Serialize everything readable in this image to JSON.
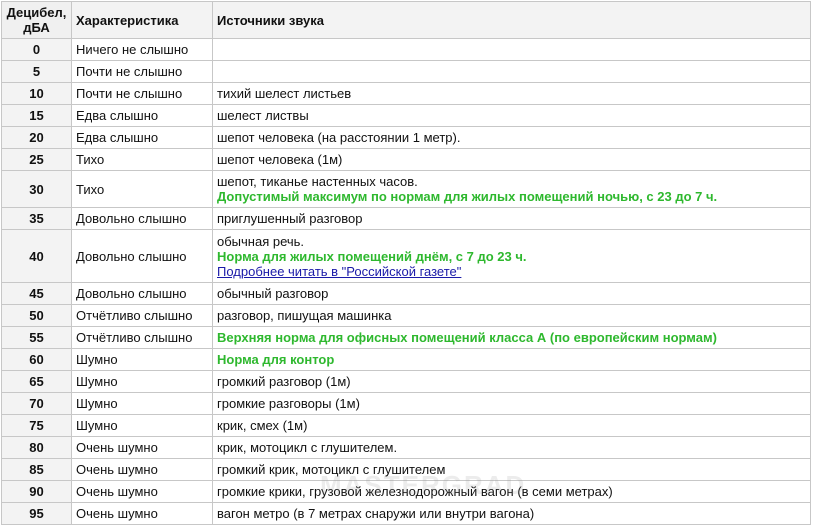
{
  "header": {
    "db": "Децибел, дБА",
    "char": "Характеристика",
    "src": "Источники звука"
  },
  "rows": [
    {
      "db": "0",
      "char": "Ничего не слышно",
      "src": ""
    },
    {
      "db": "5",
      "char": "Почти не слышно",
      "src": ""
    },
    {
      "db": "10",
      "char": "Почти не слышно",
      "src": "тихий шелест листьев"
    },
    {
      "db": "15",
      "char": "Едва слышно",
      "src": "шелест листвы"
    },
    {
      "db": "20",
      "char": "Едва слышно",
      "src": "шепот человека (на расстоянии 1 метр)."
    },
    {
      "db": "25",
      "char": "Тихо",
      "src": "шепот человека (1м)"
    },
    {
      "db": "30",
      "char": "Тихо",
      "src": "шепот, тиканье настенных часов.",
      "highlight": "Допустимый максимум по нормам для жилых помещений ночью, с 23 до 7 ч."
    },
    {
      "db": "35",
      "char": "Довольно слышно",
      "src": "приглушенный разговор"
    },
    {
      "db": "40",
      "char": "Довольно слышно",
      "src": "обычная речь.",
      "highlight": "Норма для жилых помещений днём, с 7 до 23 ч.",
      "link": "Подробнее читать в \"Российской газете\""
    },
    {
      "db": "45",
      "char": "Довольно слышно",
      "src": "обычный разговор"
    },
    {
      "db": "50",
      "char": "Отчётливо слышно",
      "src": "разговор, пишущая машинка"
    },
    {
      "db": "55",
      "char": "Отчётливо слышно",
      "highlight": "Верхняя норма для офисных помещений класса А (по европейским нормам)"
    },
    {
      "db": "60",
      "char": "Шумно",
      "highlight": "Норма для контор"
    },
    {
      "db": "65",
      "char": "Шумно",
      "src": "громкий разговор (1м)"
    },
    {
      "db": "70",
      "char": "Шумно",
      "src": "громкие разговоры (1м)"
    },
    {
      "db": "75",
      "char": "Шумно",
      "src": "крик, смех (1м)"
    },
    {
      "db": "80",
      "char": "Очень шумно",
      "src": "крик, мотоцикл с глушителем."
    },
    {
      "db": "85",
      "char": "Очень шумно",
      "src": "громкий крик, мотоцикл с глушителем"
    },
    {
      "db": "90",
      "char": "Очень шумно",
      "src": "громкие крики, грузовой железнодорожный вагон (в семи метрах)"
    },
    {
      "db": "95",
      "char": "Очень шумно",
      "src": "вагон метро (в 7 метрах снаружи или внутри вагона)"
    }
  ],
  "watermark": "MASTERGRAD"
}
